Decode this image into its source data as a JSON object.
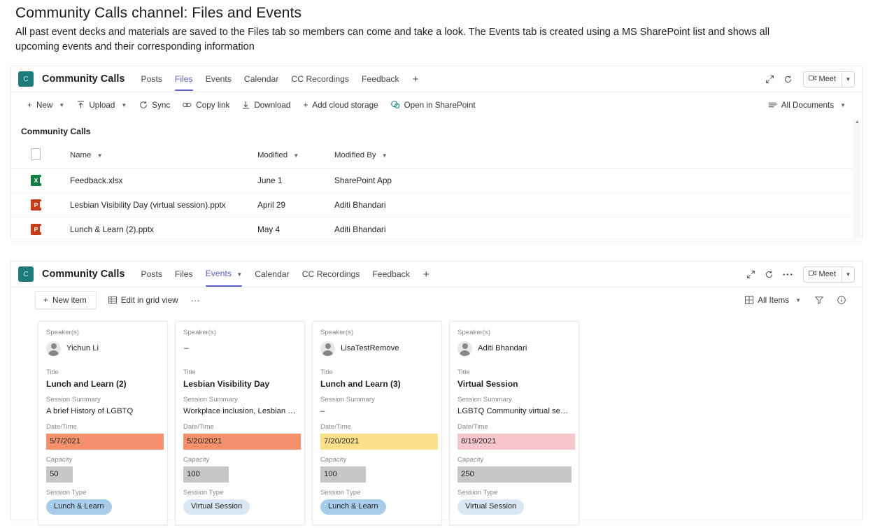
{
  "slide": {
    "title": "Community Calls channel: Files and Events",
    "subtitle": "All past event decks and materials are saved to the Files tab so members can come and take a look. The Events tab is created using a MS SharePoint list and shows all upcoming events and their corresponding information"
  },
  "colors": {
    "accent_purple": "#5b5fc7",
    "team_avatar_teal": "#1f7a7a",
    "excel_green": "#107c41",
    "powerpoint_orange": "#c43e1c",
    "date_orange": "#f4916c",
    "date_yellow": "#fbdf8a",
    "date_pink": "#f8c6ce",
    "capacity_grey": "#c7c7c7",
    "pill_lunch_learn": "#a8cdea",
    "pill_virtual_session": "#d9e6f3"
  },
  "files_window": {
    "team_avatar_letter": "C",
    "channel_name": "Community Calls",
    "tabs": [
      {
        "label": "Posts",
        "active": false,
        "caret": false
      },
      {
        "label": "Files",
        "active": true,
        "caret": false
      },
      {
        "label": "Events",
        "active": false,
        "caret": false
      },
      {
        "label": "Calendar",
        "active": false,
        "caret": false
      },
      {
        "label": "CC Recordings",
        "active": false,
        "caret": false
      },
      {
        "label": "Feedback",
        "active": false,
        "caret": false
      }
    ],
    "add_tab_label": "+",
    "header_icons": [
      "expand-icon",
      "refresh-icon"
    ],
    "meet_label": "Meet",
    "commands": [
      {
        "label": "New",
        "icon": "plus-icon",
        "caret": true
      },
      {
        "label": "Upload",
        "icon": "upload-icon",
        "caret": true
      },
      {
        "label": "Sync",
        "icon": "sync-icon",
        "caret": false
      },
      {
        "label": "Copy link",
        "icon": "link-icon",
        "caret": false
      },
      {
        "label": "Download",
        "icon": "download-icon",
        "caret": false
      },
      {
        "label": "Add cloud storage",
        "icon": "plus-icon",
        "caret": false
      },
      {
        "label": "Open in SharePoint",
        "icon": "sharepoint-icon",
        "caret": false
      }
    ],
    "view_selector": "All Documents",
    "breadcrumb": "Community Calls",
    "table": {
      "columns": [
        "Name",
        "Modified",
        "Modified By"
      ],
      "rows": [
        {
          "icon": "excel-file-icon",
          "ext": "X",
          "name": "Feedback.xlsx",
          "modified": "June 1",
          "modified_by": "SharePoint App"
        },
        {
          "icon": "powerpoint-file-icon",
          "ext": "P",
          "name": "Lesbian Visibility Day (virtual session).pptx",
          "modified": "April 29",
          "modified_by": "Aditi Bhandari"
        },
        {
          "icon": "powerpoint-file-icon",
          "ext": "P",
          "name": "Lunch & Learn (2).pptx",
          "modified": "May 4",
          "modified_by": "Aditi Bhandari"
        }
      ]
    }
  },
  "events_window": {
    "team_avatar_letter": "C",
    "channel_name": "Community Calls",
    "tabs": [
      {
        "label": "Posts",
        "active": false,
        "caret": false
      },
      {
        "label": "Files",
        "active": false,
        "caret": false
      },
      {
        "label": "Events",
        "active": true,
        "caret": true
      },
      {
        "label": "Calendar",
        "active": false,
        "caret": false
      },
      {
        "label": "CC Recordings",
        "active": false,
        "caret": false
      },
      {
        "label": "Feedback",
        "active": false,
        "caret": false
      }
    ],
    "add_tab_label": "+",
    "header_icons": [
      "expand-icon",
      "refresh-icon",
      "more-options-icon"
    ],
    "meet_label": "Meet",
    "new_item_label": "New item",
    "edit_grid_label": "Edit in grid view",
    "more_label": "···",
    "view_selector": "All Items",
    "field_labels": {
      "speakers": "Speaker(s)",
      "title": "Title",
      "summary": "Session Summary",
      "datetime": "Date/Time",
      "capacity": "Capacity",
      "session_type": "Session Type"
    },
    "cards": [
      {
        "speaker": "Yichun Li",
        "has_avatar": true,
        "title": "Lunch and Learn (2)",
        "summary": "A brief History of LGBTQ",
        "datetime": "5/7/2021",
        "datetime_color": "#f4916c",
        "datetime_width": 163,
        "capacity": "50",
        "capacity_width": 38,
        "session_type": "Lunch & Learn",
        "pill_class": "pill-ll"
      },
      {
        "speaker": "–",
        "has_avatar": false,
        "title": "Lesbian Visibility Day",
        "summary": "Workplace inclusion, Lesbian visibi...",
        "datetime": "5/20/2021",
        "datetime_color": "#f4916c",
        "datetime_width": 163,
        "capacity": "100",
        "capacity_width": 65,
        "session_type": "Virtual Session",
        "pill_class": "pill-vs"
      },
      {
        "speaker": "LisaTestRemove",
        "has_avatar": true,
        "title": "Lunch and Learn (3)",
        "summary": "–",
        "datetime": "7/20/2021",
        "datetime_color": "#fbdf8a",
        "datetime_width": 163,
        "capacity": "100",
        "capacity_width": 65,
        "session_type": "Lunch & Learn",
        "pill_class": "pill-ll"
      },
      {
        "speaker": "Aditi Bhandari",
        "has_avatar": true,
        "title": "Virtual Session",
        "summary": "LGBTQ Community virtual session",
        "datetime": "8/19/2021",
        "datetime_color": "#f8c6ce",
        "datetime_width": 163,
        "capacity": "250",
        "capacity_width": 163,
        "session_type": "Virtual Session",
        "pill_class": "pill-vs"
      }
    ]
  }
}
